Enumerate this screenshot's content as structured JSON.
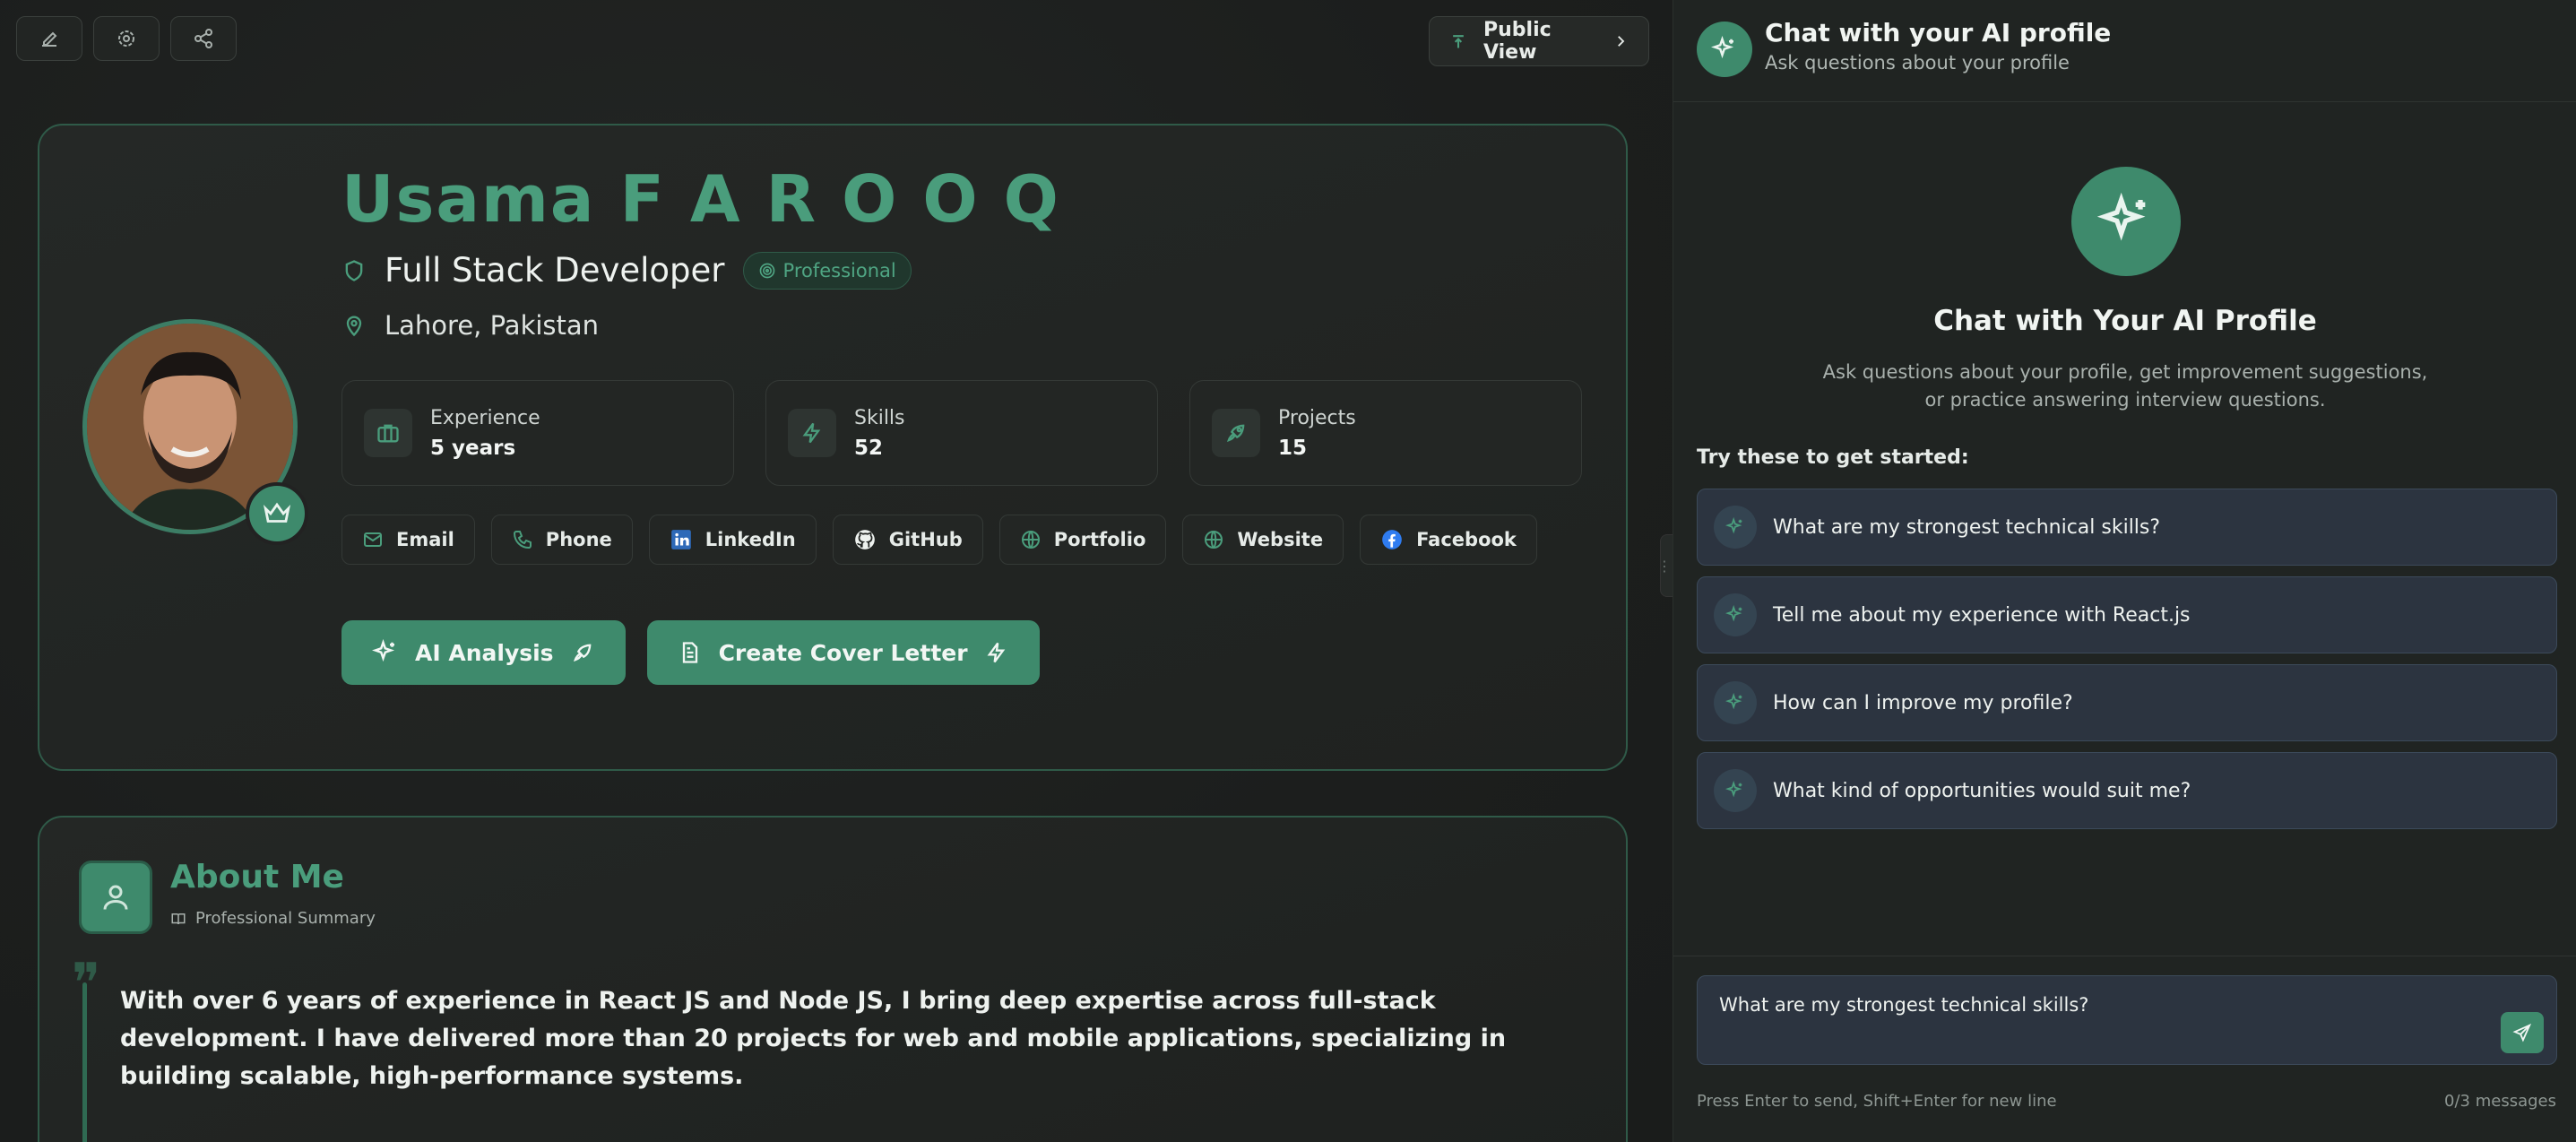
{
  "toolbar": {
    "edit_icon": "edit-icon",
    "settings_icon": "settings-icon",
    "share_icon": "share-icon",
    "public_view_label": "Public View"
  },
  "profile": {
    "name": "Usama F A R O O Q",
    "role": "Full Stack Developer",
    "badge": "Professional",
    "location": "Lahore, Pakistan",
    "stats": [
      {
        "label": "Experience",
        "value": "5 years"
      },
      {
        "label": "Skills",
        "value": "52"
      },
      {
        "label": "Projects",
        "value": "15"
      }
    ],
    "links": [
      "Email",
      "Phone",
      "LinkedIn",
      "GitHub",
      "Portfolio",
      "Website",
      "Facebook"
    ],
    "actions": [
      "AI Analysis",
      "Create Cover Letter"
    ]
  },
  "about": {
    "title": "About Me",
    "subtitle": "Professional Summary",
    "text": "With over 6 years of experience in React JS and Node JS, I bring deep expertise across full-stack development. I have delivered more than 20 projects for web and mobile applications, specializing in building scalable, high-performance systems."
  },
  "chat": {
    "header_title": "Chat with your AI profile",
    "header_subtitle": "Ask questions about your profile",
    "hero_title": "Chat with Your AI Profile",
    "hero_desc": "Ask questions about your profile, get improvement suggestions, or practice answering interview questions.",
    "try_label": "Try these to get started:",
    "suggestions": [
      "What are my strongest technical skills?",
      "Tell me about my experience with React.js",
      "How can I improve my profile?",
      "What kind of opportunities would suit me?"
    ],
    "input_value": "What are my strongest technical skills?",
    "hint": "Press Enter to send, Shift+Enter for new line",
    "count": "0/3 messages"
  },
  "colors": {
    "accent": "#3e8a6c",
    "accent_text": "#4a9d7c",
    "background": "#1b1d1c",
    "panel": "#202422"
  }
}
